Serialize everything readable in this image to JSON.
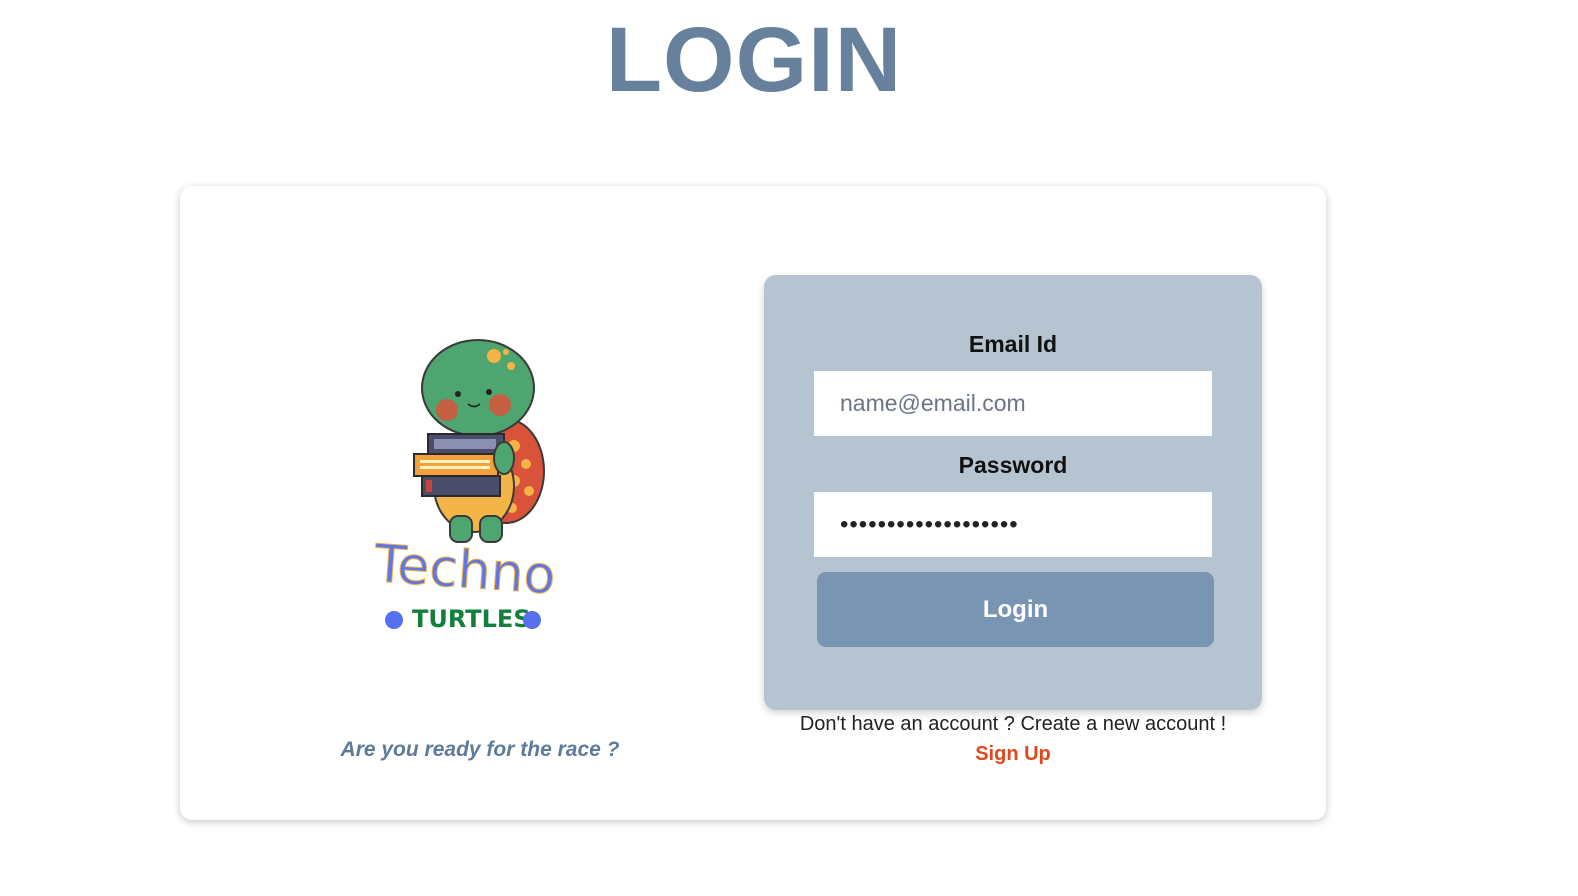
{
  "header": {
    "title": "LOGIN"
  },
  "brand": {
    "logo_word_1": "Techno",
    "logo_word_2": "TURTLES",
    "tagline": "Are you ready for the race ?"
  },
  "form": {
    "email_label": "Email Id",
    "email_placeholder": "name@email.com",
    "email_value": "",
    "password_label": "Password",
    "password_value": "...................",
    "login_label": "Login"
  },
  "footer": {
    "signup_prompt": "Don't have an account ? Create a new account !",
    "signup_link": "Sign Up"
  },
  "colors": {
    "title": "#67809b",
    "panel": "#b6c4d2",
    "button": "#7995b1",
    "link": "#e0481e"
  },
  "icons": {
    "logo": "turtle-with-books-logo"
  }
}
